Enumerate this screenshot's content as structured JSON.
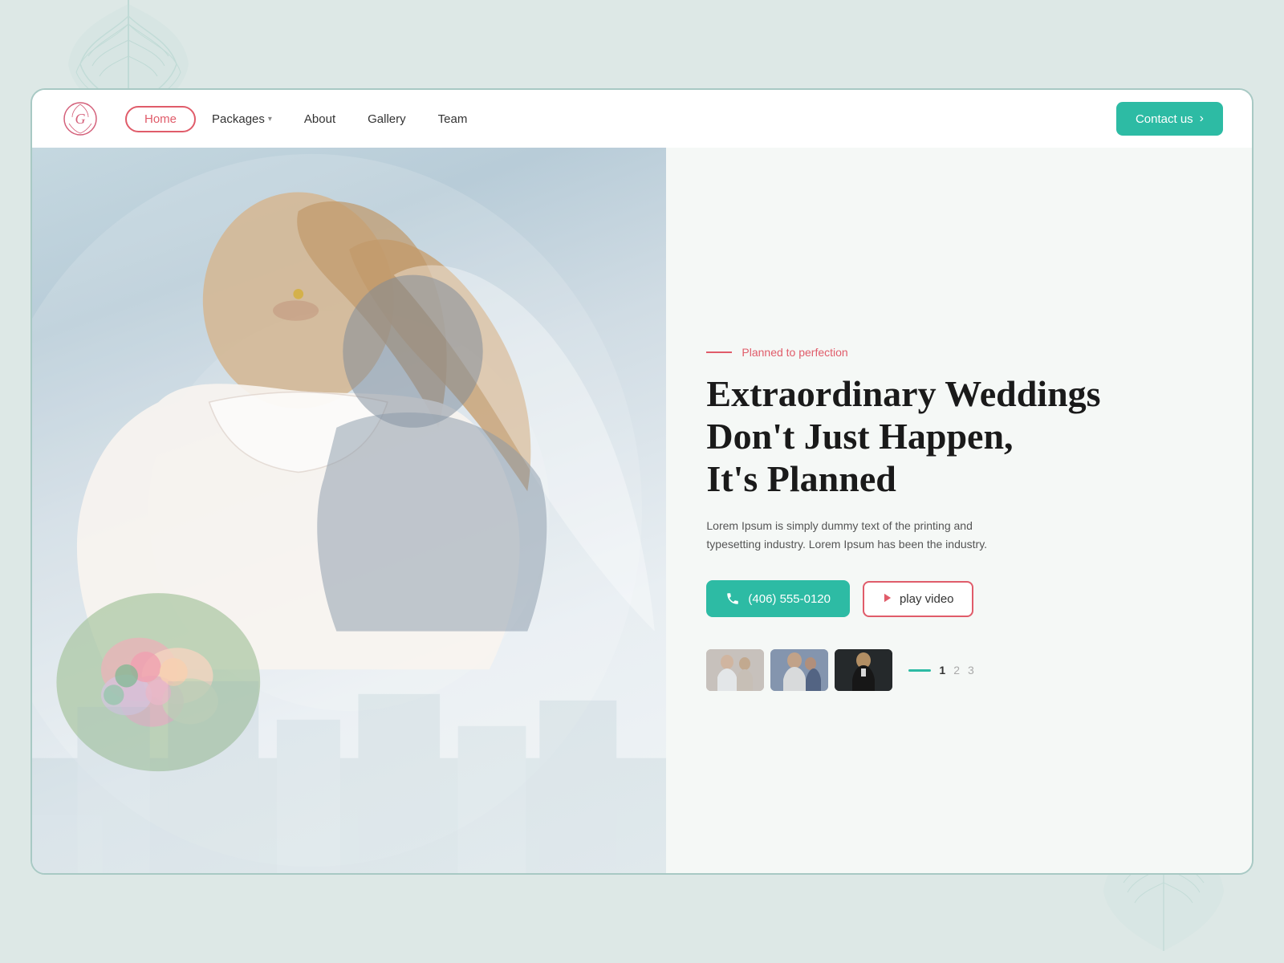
{
  "page": {
    "background_color": "#dde8e6"
  },
  "navbar": {
    "logo_letter": "G",
    "nav_items": [
      {
        "label": "Home",
        "active": true
      },
      {
        "label": "Packages",
        "has_dropdown": true
      },
      {
        "label": "About"
      },
      {
        "label": "Gallery"
      },
      {
        "label": "Team"
      }
    ],
    "contact_button": "Contact us"
  },
  "hero": {
    "tagline_line": "—",
    "tagline": "Planned to perfection",
    "title_line1": "Extraordinary Weddings",
    "title_line2": "Don't Just Happen,",
    "title_line3": "It's Planned",
    "description": "Lorem Ipsum is simply dummy text of the printing and typesetting industry. Lorem Ipsum has been the industry.",
    "phone_button": "(406) 555-0120",
    "play_button": "play video",
    "pagination": {
      "current": "1",
      "pages": [
        "1",
        "2",
        "3"
      ]
    }
  }
}
